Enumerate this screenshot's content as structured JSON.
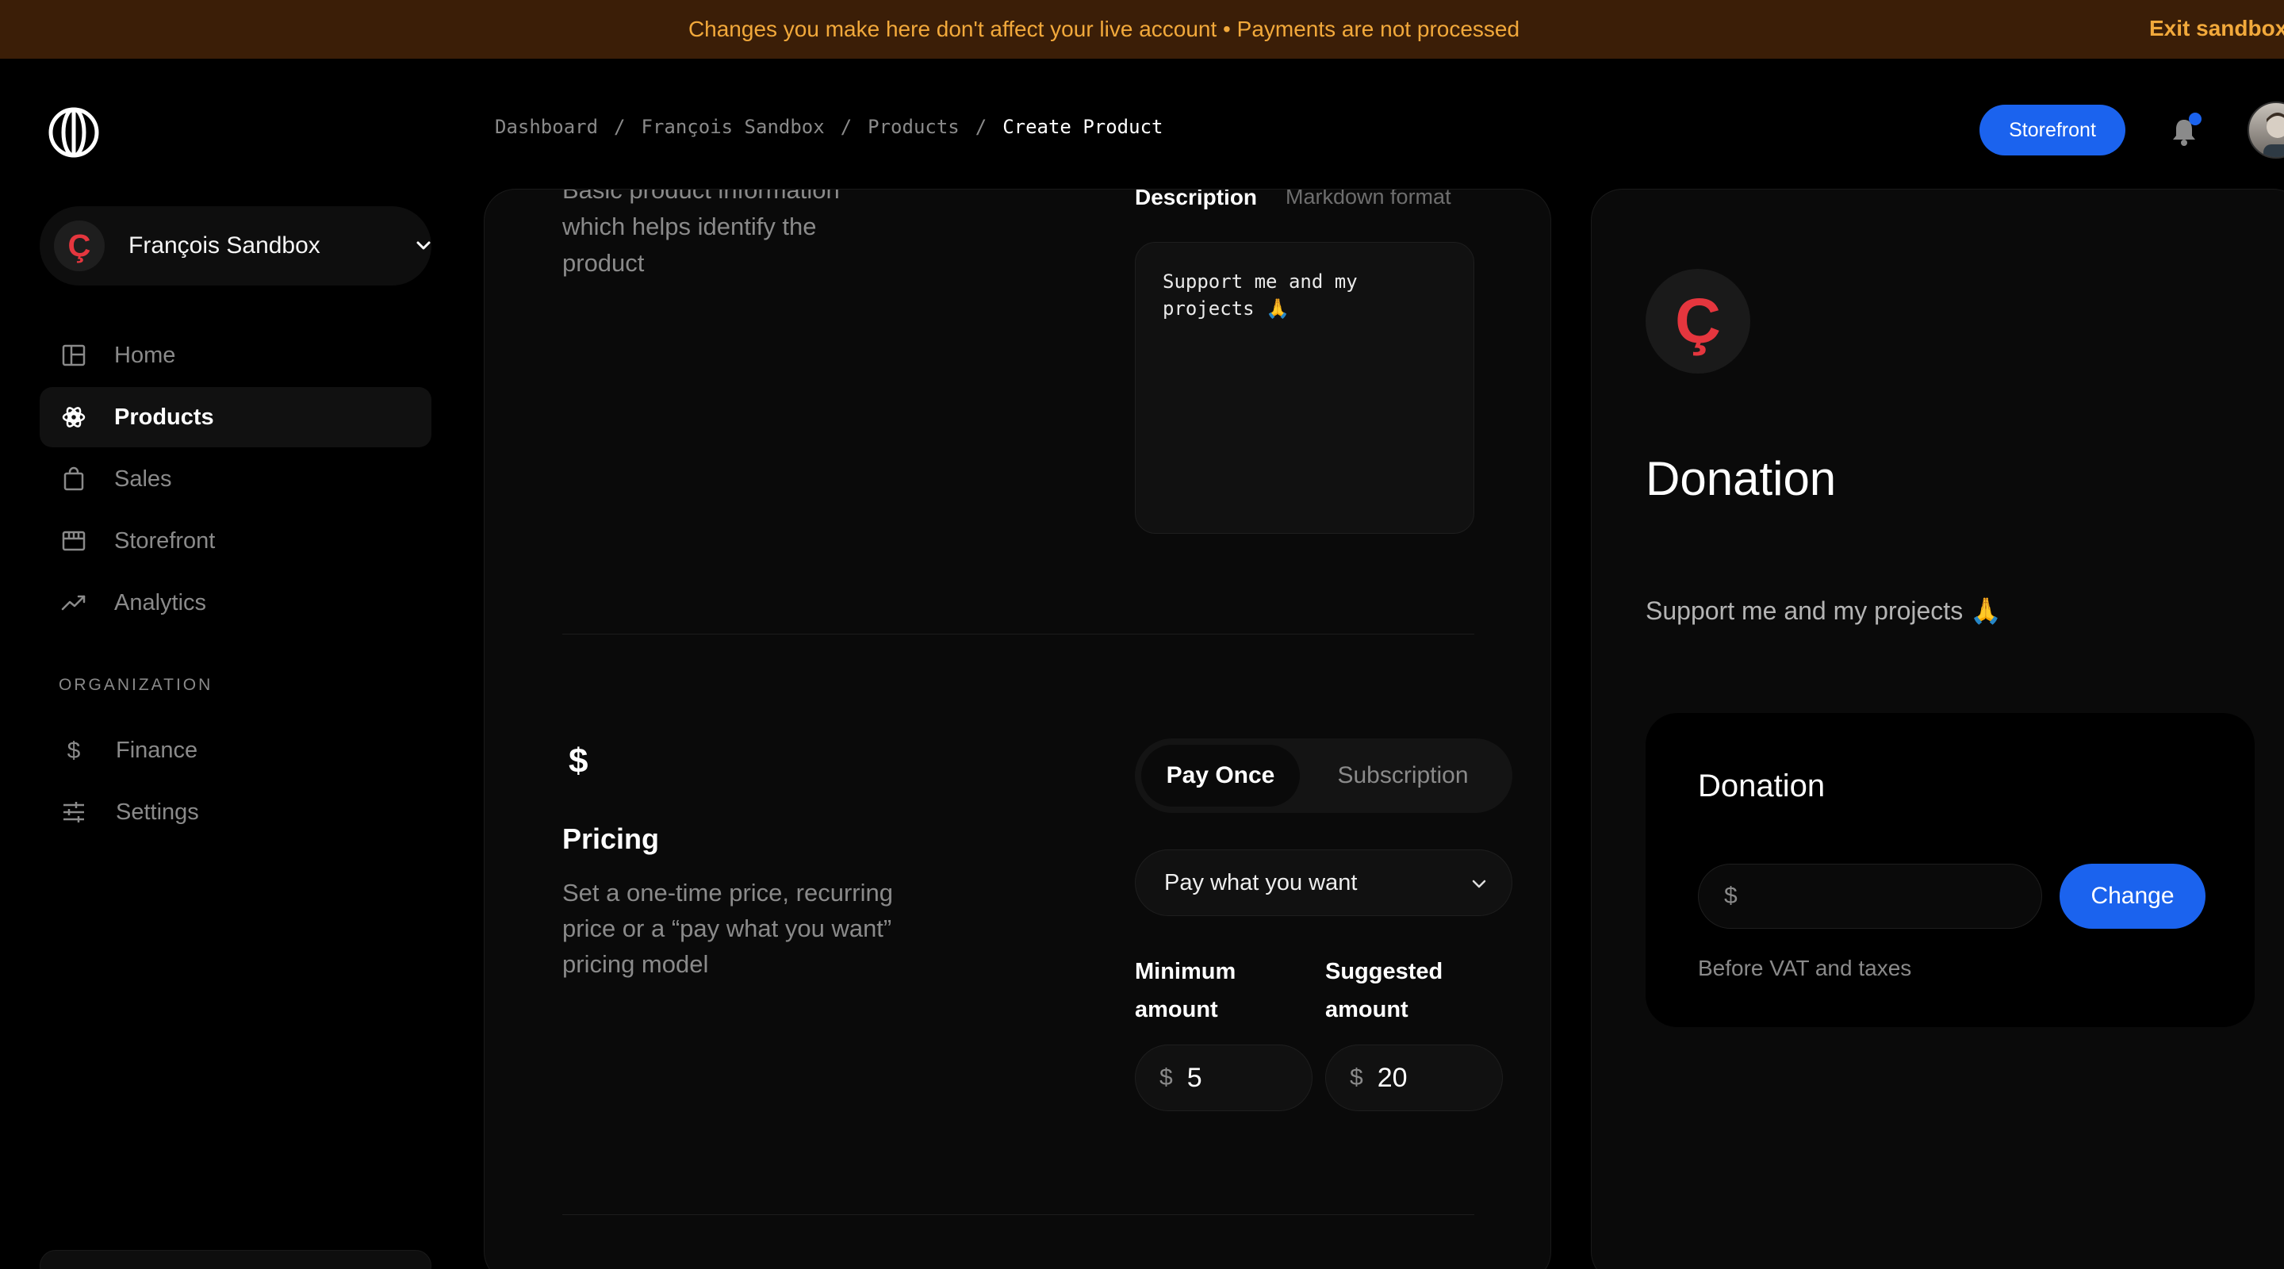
{
  "banner": {
    "message": "Changes you make here don't affect your live account • Payments are not processed",
    "exit_label": "Exit sandbox"
  },
  "sidebar": {
    "org": {
      "initial": "Ç",
      "name": "François Sandbox"
    },
    "items": [
      {
        "label": "Home",
        "icon": "home-icon",
        "active": false
      },
      {
        "label": "Products",
        "icon": "products-icon",
        "active": true
      },
      {
        "label": "Sales",
        "icon": "shopping-bag-icon",
        "active": false
      },
      {
        "label": "Storefront",
        "icon": "store-icon",
        "active": false
      },
      {
        "label": "Analytics",
        "icon": "trend-up-icon",
        "active": false
      }
    ],
    "section_label": "ORGANIZATION",
    "org_items": [
      {
        "label": "Finance",
        "icon": "dollar-icon"
      },
      {
        "label": "Settings",
        "icon": "sliders-icon"
      }
    ]
  },
  "header": {
    "breadcrumb": [
      "Dashboard",
      "François Sandbox",
      "Products",
      "Create Product"
    ],
    "separator": "/",
    "storefront_label": "Storefront"
  },
  "form": {
    "basic_info_desc": "Basic product information which helps identify the product",
    "description_label": "Description",
    "description_hint": "Markdown format",
    "description_value": "Support me and my projects 🙏",
    "pricing": {
      "icon_glyph": "$",
      "title": "Pricing",
      "description": "Set a one-time price, recurring price or a “pay what you want” pricing model",
      "tabs": [
        "Pay Once",
        "Subscription"
      ],
      "active_tab": "Pay Once",
      "model_selected": "Pay what you want",
      "currency_symbol": "$",
      "minimum_label": "Minimum amount",
      "minimum_value": "5",
      "suggested_label": "Suggested amount",
      "suggested_value": "20"
    }
  },
  "preview": {
    "avatar_initial": "Ç",
    "title": "Donation",
    "description": "Support me and my projects 🙏",
    "box": {
      "title": "Donation",
      "currency_symbol": "$",
      "change_label": "Change",
      "note": "Before VAT and taxes"
    }
  },
  "colors": {
    "banner_bg": "#3b1e07",
    "banner_text": "#f2a93b",
    "accent_blue": "#1b63ee",
    "brand_red": "#e5363e"
  }
}
